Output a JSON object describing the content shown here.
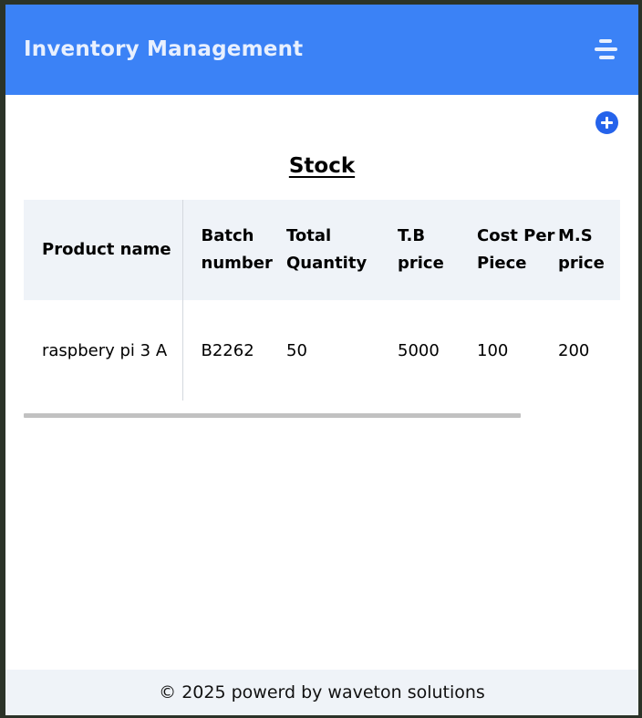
{
  "header": {
    "title": "Inventory Management",
    "menu_icon": "hamburger-menu-icon"
  },
  "main": {
    "add_icon": "plus-circle-icon",
    "section_title": "Stock",
    "table": {
      "columns": [
        "Product name",
        "Batch number",
        "Total Quantity",
        "T.B price",
        "Cost Per Piece",
        "M.S price"
      ],
      "rows": [
        [
          "raspbery pi 3 A",
          "B2262",
          "50",
          "5000",
          "100",
          "200"
        ]
      ]
    }
  },
  "footer": {
    "text": "© 2025 powerd by waveton solutions"
  },
  "colors": {
    "header_bg": "#3b82f6",
    "accent": "#2563eb",
    "table_header_bg": "#eff3f8",
    "footer_bg": "#eff3f8"
  }
}
